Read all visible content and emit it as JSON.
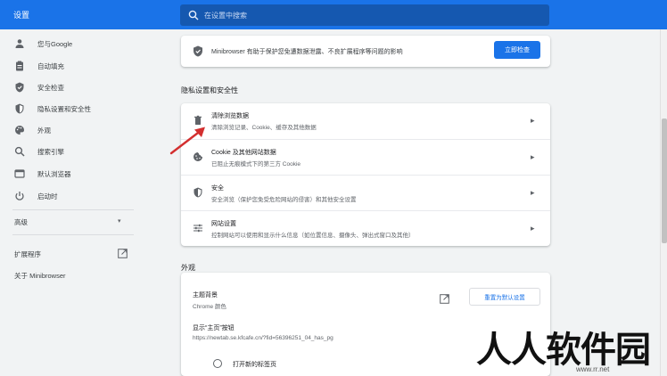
{
  "header": {
    "app_title": "设置",
    "search_placeholder": "在设置中搜索"
  },
  "sidebar": {
    "items": [
      {
        "label": "您与Google",
        "icon": "person-icon"
      },
      {
        "label": "自动填充",
        "icon": "clipboard-icon"
      },
      {
        "label": "安全检查",
        "icon": "shield-icon"
      },
      {
        "label": "隐私设置和安全性",
        "icon": "shield-lock-icon"
      },
      {
        "label": "外观",
        "icon": "palette-icon"
      },
      {
        "label": "搜索引擎",
        "icon": "search-icon"
      },
      {
        "label": "默认浏览器",
        "icon": "browser-icon"
      },
      {
        "label": "启动时",
        "icon": "power-icon"
      }
    ],
    "advanced_label": "高级",
    "extensions_label": "扩展程序",
    "about_label": "关于 Minibrowser"
  },
  "safety_check": {
    "text": "Minibrowser 有助于保护您免遭数据泄露、不良扩展程序等问题的影响",
    "button_label": "立即检查"
  },
  "privacy": {
    "section_title": "隐私设置和安全性",
    "rows": [
      {
        "title": "清除浏览数据",
        "subtitle": "清除浏览记录、Cookie、缓存及其他数据",
        "icon": "trash-icon"
      },
      {
        "title": "Cookie 及其他网站数据",
        "subtitle": "已阻止无痕模式下的第三方 Cookie",
        "icon": "cookie-icon"
      },
      {
        "title": "安全",
        "subtitle": "安全浏览（保护您免受危险网站的侵害）和其他安全设置",
        "icon": "shield-icon"
      },
      {
        "title": "网站设置",
        "subtitle": "控制网站可以使用和显示什么信息（如位置信息、摄像头、弹出式窗口及其他）",
        "icon": "sliders-icon"
      }
    ]
  },
  "appearance": {
    "section_title": "外观",
    "theme_title": "主题背景",
    "theme_subtitle": "Chrome 颜色",
    "reset_button": "重置为默认设置",
    "home_title": "显示“主页”按钮",
    "home_url": "https://newtab.se.kfcafe.cn/?fid=56396251_04_has_pg",
    "radio_label": "打开新的标签页"
  },
  "watermark": {
    "text": "人人软件园",
    "url": "www.rr.net"
  },
  "colors": {
    "header_blue": "#1a73e8",
    "annotation_red": "#d32f2f"
  }
}
